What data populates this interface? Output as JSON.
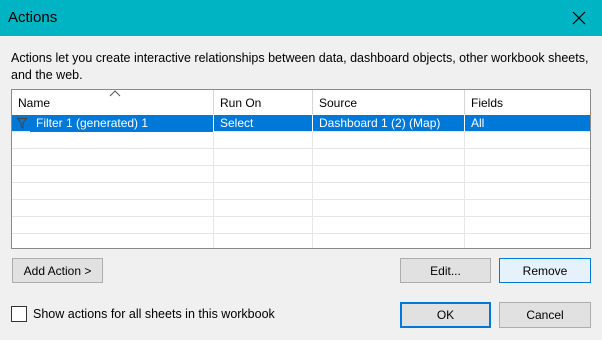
{
  "window": {
    "title": "Actions"
  },
  "description": "Actions let you create interactive relationships between data, dashboard objects, other workbook sheets, and the web.",
  "table": {
    "columns": [
      "Name",
      "Run On",
      "Source",
      "Fields"
    ],
    "rows": [
      {
        "name": "Filter 1 (generated) 1",
        "run_on": "Select",
        "source": "Dashboard 1 (2) (Map)",
        "fields": "All",
        "icon": "filter-icon",
        "selected": true
      }
    ]
  },
  "buttons": {
    "add_action": "Add Action >",
    "edit": "Edit...",
    "remove": "Remove",
    "ok": "OK",
    "cancel": "Cancel"
  },
  "checkbox": {
    "label": "Show actions for all sheets in this workbook",
    "checked": false
  },
  "colors": {
    "titlebar": "#00b4c3",
    "selection": "#0078d7",
    "focus_border": "#0078d7"
  }
}
